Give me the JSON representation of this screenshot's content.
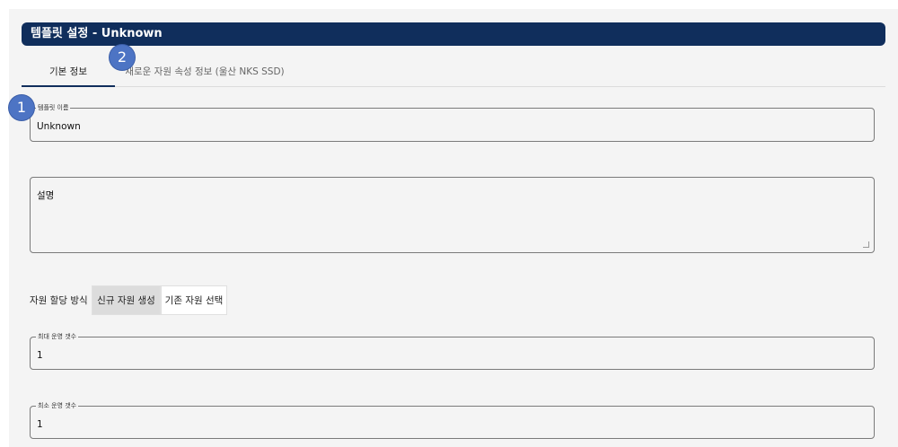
{
  "header": {
    "title": "템플릿 설정 - Unknown"
  },
  "tabs": [
    {
      "label": "기본 정보"
    },
    {
      "label": "새로운 자원 속성 정보 (울산 NKS SSD)"
    }
  ],
  "badges": [
    "1",
    "2"
  ],
  "form": {
    "template_name": {
      "label": "템플릿 이름",
      "value": "Unknown"
    },
    "description": {
      "placeholder": "설명"
    },
    "allocation": {
      "label": "자원 할당 방식",
      "options": [
        "신규 자원 생성",
        "기존 자원 선택"
      ],
      "selected": "신규 자원 생성"
    },
    "max_count": {
      "label": "최대 운영 갯수",
      "value": "1"
    },
    "min_count": {
      "label": "최소 운영 갯수",
      "value": "1"
    }
  },
  "colors": {
    "header_bg": "#102e5c",
    "badge": "#4d74c4",
    "panel_bg": "#f4f4f4"
  }
}
